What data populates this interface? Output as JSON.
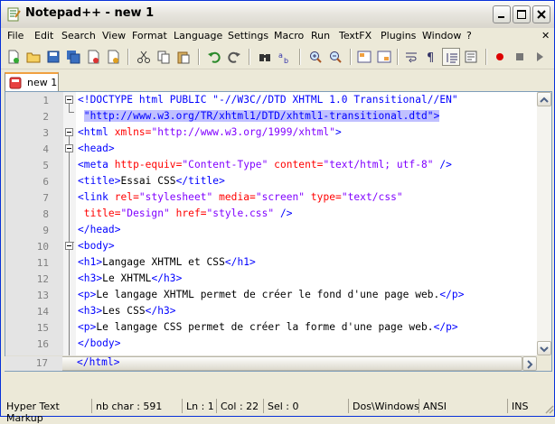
{
  "window": {
    "title": "Notepad++ - new 1"
  },
  "menu": [
    "File",
    "Edit",
    "Search",
    "View",
    "Format",
    "Language",
    "Settings",
    "Macro",
    "Run",
    "TextFX",
    "Plugins",
    "Window",
    "?"
  ],
  "tab": {
    "label": "new 1"
  },
  "code_lines": [
    {
      "n": "1"
    },
    {
      "n": "2"
    },
    {
      "n": "3"
    },
    {
      "n": "4"
    },
    {
      "n": "5"
    },
    {
      "n": "6"
    },
    {
      "n": "7"
    },
    {
      "n": "8"
    },
    {
      "n": "9"
    },
    {
      "n": "10"
    },
    {
      "n": "11"
    },
    {
      "n": "12"
    },
    {
      "n": "13"
    },
    {
      "n": "14"
    },
    {
      "n": "15"
    },
    {
      "n": "16"
    },
    {
      "n": "17"
    }
  ],
  "code": {
    "l1a": "<!DOCTYPE html PUBLIC \"-//W3C//DTD XHTML 1.0 Transitional//EN\"",
    "l2a": "\"http://www.w3.org/TR/xhtml1/DTD/xhtml1-transitional.dtd\">",
    "l3_tag": "<html",
    "l3_attr": " xmlns=",
    "l3_val": "\"http://www.w3.org/1999/xhtml\"",
    "l3_end": ">",
    "l4": "<head>",
    "l5_tag": "<meta",
    "l5_attr1": " http-equiv=",
    "l5_val1": "\"Content-Type\"",
    "l5_attr2": " content=",
    "l5_val2": "\"text/html; utf-8\"",
    "l5_end": " />",
    "l6_open": "<title>",
    "l6_text": "Essai CSS",
    "l6_close": "</title>",
    "l7_tag": "<link",
    "l7_attr1": " rel=",
    "l7_val1": "\"stylesheet\"",
    "l7_attr2": " media=",
    "l7_val2": "\"screen\"",
    "l7_attr3": " type=",
    "l7_val3": "\"text/css\"",
    "l8_attr1": " title=",
    "l8_val1": "\"Design\"",
    "l8_attr2": " href=",
    "l8_val2": "\"style.css\"",
    "l8_end": " />",
    "l9": "</head>",
    "l10": "<body>",
    "l11_open": "<h1>",
    "l11_text": "Langage XHTML et CSS",
    "l11_close": "</h1>",
    "l12_open": "<h3>",
    "l12_text": "Le XHTML",
    "l12_close": "</h3>",
    "l13_open": "<p>",
    "l13_text": "Le langage XHTML permet de créer le fond d'une page web.",
    "l13_close": "</p>",
    "l14_open": "<h3>",
    "l14_text": "Les CSS",
    "l14_close": "</h3>",
    "l15_open": "<p>",
    "l15_text": "Le langage CSS permet de créer la forme d'une page web.",
    "l15_close": "</p>",
    "l16": "</body>",
    "l17": "</html>"
  },
  "status": {
    "language": "Hyper Text Markup",
    "nb_char": "nb char : 591",
    "ln": "Ln : 1",
    "col": "Col : 22",
    "sel": "Sel : 0",
    "eol": "Dos\\Windows",
    "encoding": "ANSI",
    "mode": "INS"
  },
  "colors": {
    "tag": "#0000ff",
    "attr": "#ff0000",
    "value": "#8000ff",
    "selection": "#c0c0ff"
  }
}
